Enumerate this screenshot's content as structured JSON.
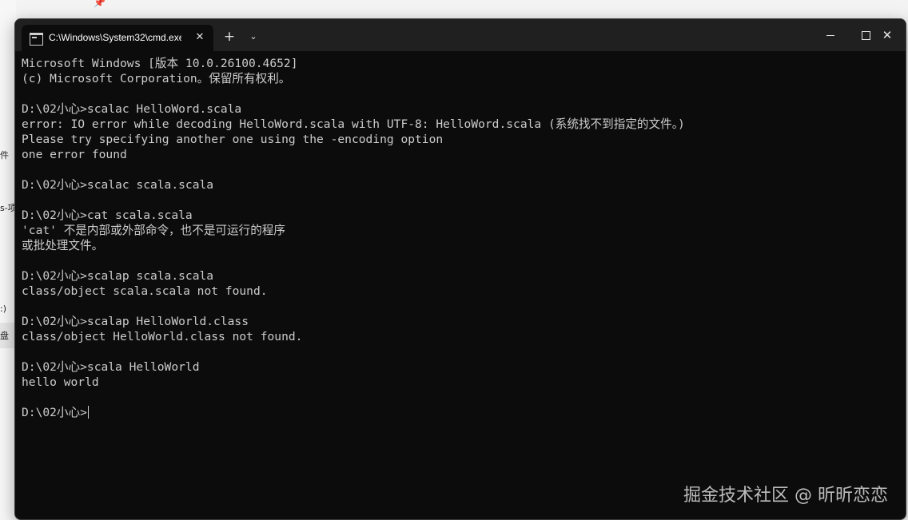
{
  "background": {
    "fragments": [
      "件",
      "s-项",
      ":)",
      "盘"
    ]
  },
  "window": {
    "tab_title": "C:\\Windows\\System32\\cmd.exe",
    "tab_close_icon": "close-icon",
    "new_tab_label": "+",
    "dropdown_icon": "chevron-down-icon",
    "controls": {
      "minimize_icon": "minimize-icon",
      "maximize_icon": "maximize-icon",
      "close_icon": "close-icon"
    }
  },
  "console": {
    "lines": [
      "Microsoft Windows [版本 10.0.26100.4652]",
      "(c) Microsoft Corporation。保留所有权利。",
      "",
      "D:\\02小心>scalac HelloWord.scala",
      "error: IO error while decoding HelloWord.scala with UTF-8: HelloWord.scala (系统找不到指定的文件。)",
      "Please try specifying another one using the -encoding option",
      "one error found",
      "",
      "D:\\02小心>scalac scala.scala",
      "",
      "D:\\02小心>cat scala.scala",
      "'cat' 不是内部或外部命令，也不是可运行的程序",
      "或批处理文件。",
      "",
      "D:\\02小心>scalap scala.scala",
      "class/object scala.scala not found.",
      "",
      "D:\\02小心>scalap HelloWorld.class",
      "class/object HelloWorld.class not found.",
      "",
      "D:\\02小心>scala HelloWorld",
      "hello world",
      ""
    ],
    "prompt": "D:\\02小心>"
  },
  "watermark": "掘金技术社区 @ 昕昕恋恋",
  "colors": {
    "terminal_bg": "#0c0c0c",
    "titlebar_bg": "#202020",
    "text": "#cccccc"
  }
}
